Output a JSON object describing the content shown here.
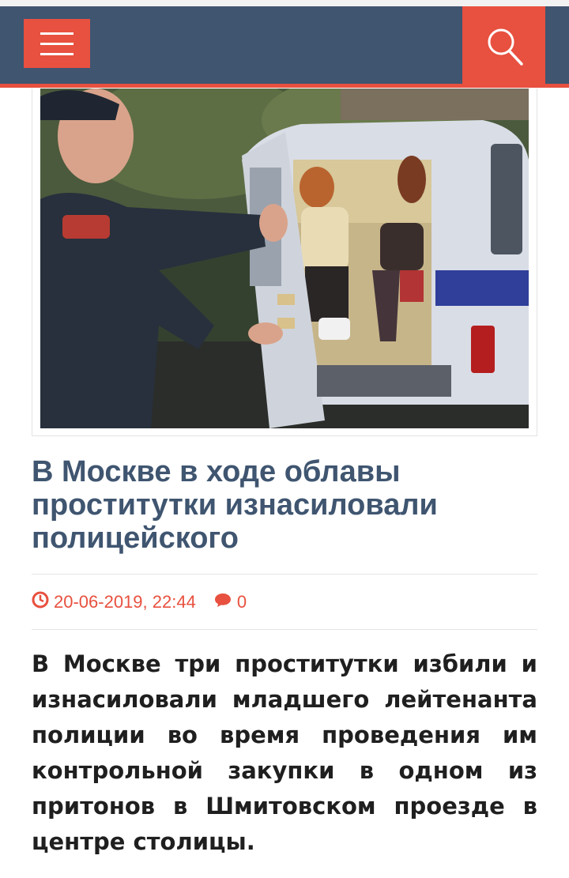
{
  "header": {
    "menu_icon": "hamburger-menu-icon",
    "search_icon": "search-icon",
    "colors": {
      "bar": "#3f5570",
      "accent": "#e8503f"
    }
  },
  "article": {
    "image_alt": "Police officer opening door of police van with women inside",
    "title": "В Москве в ходе облавы проститутки изнасиловали полицейского",
    "date": "20-06-2019, 22:44",
    "comments_count": "0",
    "lead": "В Москве три проститутки избили и изнасиловали младшего лейтенанта полиции во время проведения им контрольной закупки в одном из притонов в Шмитовском проезде в центре столицы."
  }
}
